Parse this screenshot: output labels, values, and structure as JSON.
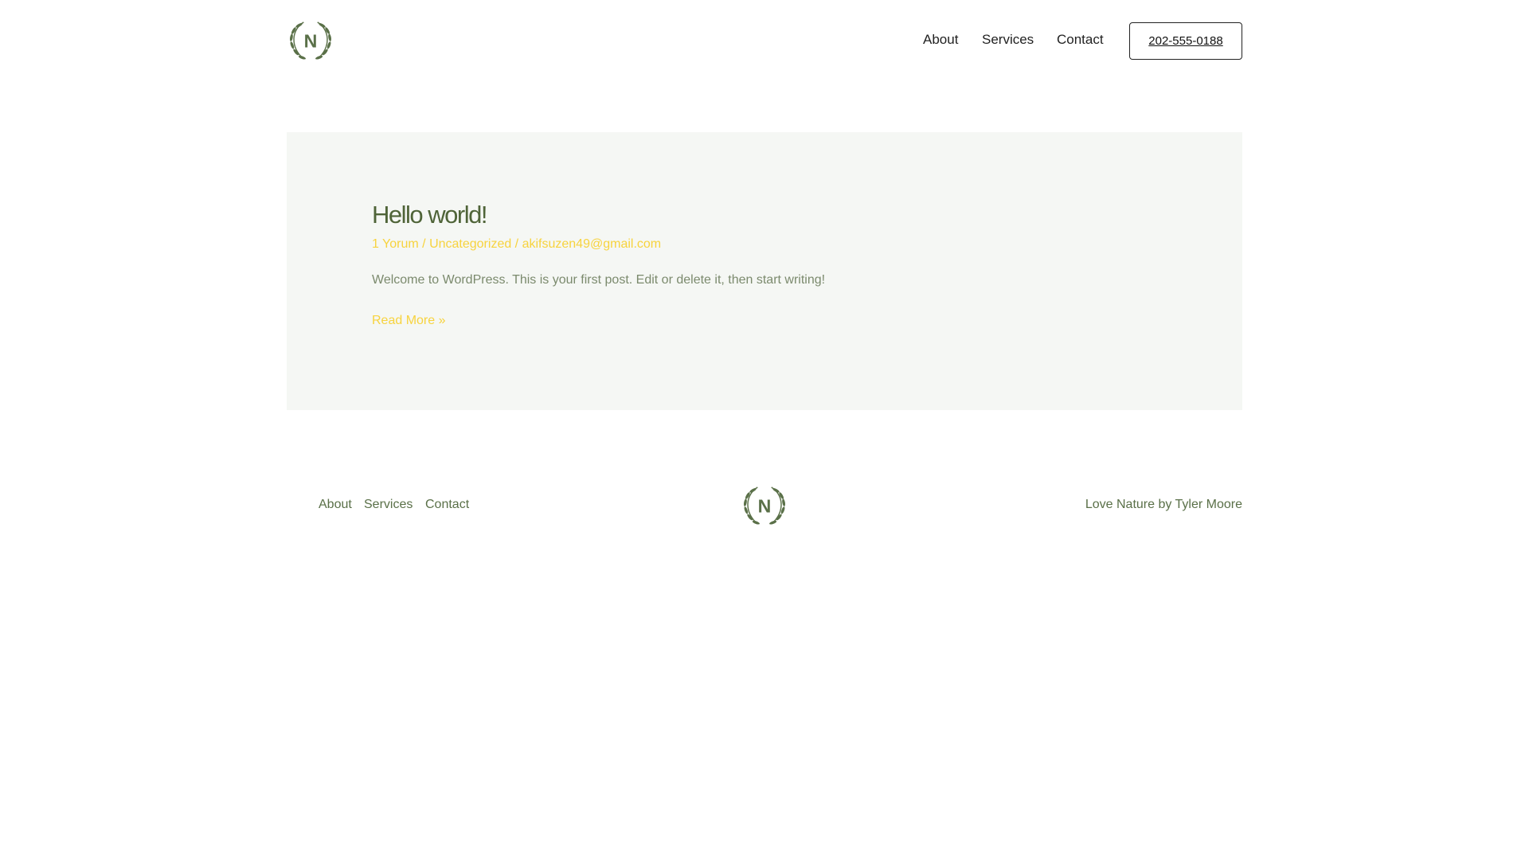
{
  "header": {
    "logo_letter": "N",
    "nav": [
      "About",
      "Services",
      "Contact"
    ],
    "phone": "202-555-0188"
  },
  "post": {
    "title": "Hello world!",
    "comments": "1 Yorum",
    "category": "Uncategorized",
    "author": "akifsuzen49@gmail.com",
    "separator": " / ",
    "excerpt": "Welcome to WordPress. This is your first post. Edit or delete it, then start writing!",
    "read_more": "Read More »"
  },
  "footer": {
    "nav": [
      "About",
      "Services",
      "Contact"
    ],
    "logo_letter": "N",
    "credit": "Love Nature by Tyler Moore"
  },
  "colors": {
    "brand": "#5a7048",
    "accent": "#f7d33e",
    "card_bg": "#f5f7f4"
  }
}
